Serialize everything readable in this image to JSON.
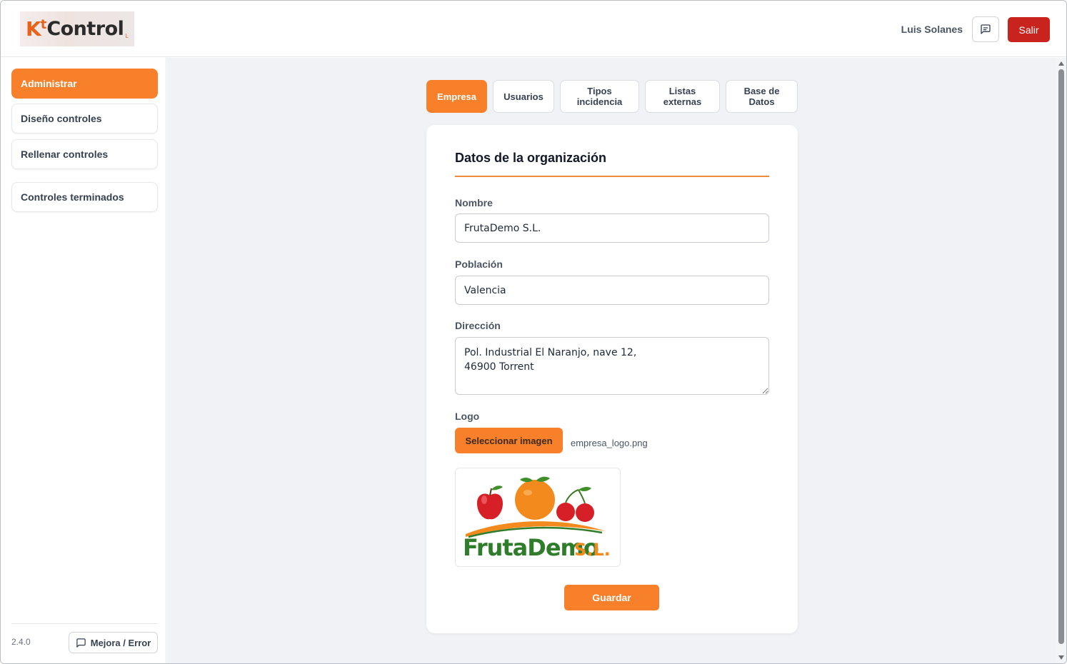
{
  "header": {
    "logo_k": "K",
    "logo_t": "t",
    "logo_rest": "Control",
    "logo_sub": "L",
    "user_name": "Luis Solanes",
    "logout_label": "Salir",
    "message_icon": "message-square-icon"
  },
  "sidebar": {
    "items": [
      {
        "label": "Administrar",
        "active": true
      },
      {
        "label": "Diseño controles",
        "active": false
      },
      {
        "label": "Rellenar controles",
        "active": false
      },
      {
        "label": "Controles terminados",
        "active": false
      }
    ],
    "version": "2.4.0",
    "feedback_label": "Mejora / Error",
    "feedback_icon": "message-square-icon"
  },
  "tabs": [
    {
      "label": "Empresa",
      "active": true
    },
    {
      "label": "Usuarios",
      "active": false
    },
    {
      "label": "Tipos incidencia",
      "active": false
    },
    {
      "label": "Listas externas",
      "active": false
    },
    {
      "label": "Base de Datos",
      "active": false
    }
  ],
  "form": {
    "title": "Datos de la organización",
    "nombre_label": "Nombre",
    "nombre_value": "FrutaDemo S.L.",
    "poblacion_label": "Población",
    "poblacion_value": "Valencia",
    "direccion_label": "Dirección",
    "direccion_value": "Pol. Industrial El Naranjo, nave 12,\n46900 Torrent",
    "logo_label": "Logo",
    "select_image_label": "Seleccionar imagen",
    "file_name": "empresa_logo.png",
    "logo_text_main": "FrutaDemo",
    "logo_text_suffix": "S.L.",
    "save_label": "Guardar"
  },
  "colors": {
    "accent": "#f9802a",
    "danger": "#c8231c",
    "logo_green": "#2f7d2b",
    "logo_orange": "#f28a1e",
    "logo_red": "#d61f26"
  }
}
